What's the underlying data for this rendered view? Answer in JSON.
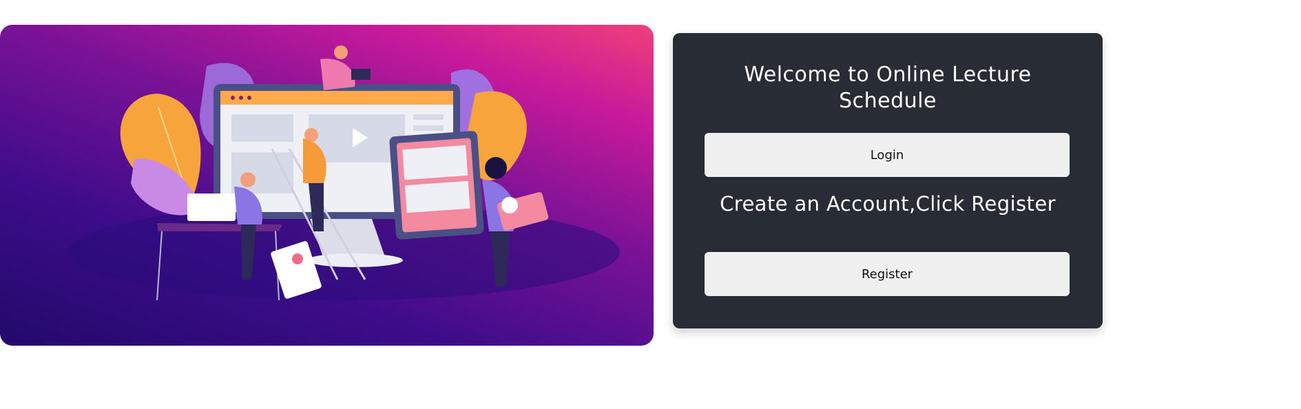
{
  "hero": {
    "image_name": "online-learning-illustration"
  },
  "card": {
    "title": "Welcome to Online Lecture Schedule",
    "login_label": "Login",
    "register_prompt": "Create an Account,Click Register",
    "register_label": "Register"
  },
  "colors": {
    "card_background": "#282c34",
    "button_background": "#f0f0f0",
    "hero_gradient_start": "#f0407a",
    "hero_gradient_end": "#220a6a"
  }
}
